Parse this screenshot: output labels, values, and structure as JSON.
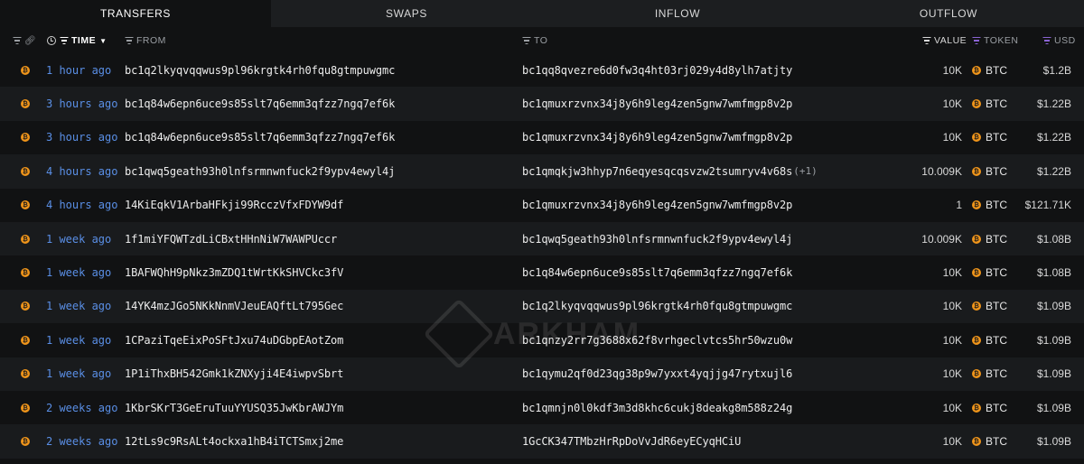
{
  "tabs": [
    {
      "label": "TRANSFERS",
      "active": true
    },
    {
      "label": "SWAPS",
      "active": false
    },
    {
      "label": "INFLOW",
      "active": false
    },
    {
      "label": "OUTFLOW",
      "active": false
    }
  ],
  "columns": {
    "time": "TIME",
    "from": "FROM",
    "to": "TO",
    "value": "VALUE",
    "token": "TOKEN",
    "usd": "USD"
  },
  "colors": {
    "time_link": "#5a8fe6",
    "btc": "#f0951a",
    "accent_purple": "#8a63d2"
  },
  "icons": {
    "row": "btc-coin-icon",
    "header_filter": "filter-icon",
    "header_link": "link-icon",
    "header_time": "clock-icon"
  },
  "watermark": "ARKHAM",
  "rows": [
    {
      "time": "1 hour ago",
      "from": "bc1q2lkyqvqqwus9pl96krgtk4rh0fqu8gtmpuwgmc",
      "to": "bc1qq8qvezre6d0fw3q4ht03rj029y4d8ylh7atjty",
      "to_extra": "",
      "value": "10K",
      "token": "BTC",
      "usd": "$1.2B"
    },
    {
      "time": "3 hours ago",
      "from": "bc1q84w6epn6uce9s85slt7q6emm3qfzz7ngq7ef6k",
      "to": "bc1qmuxrzvnx34j8y6h9leg4zen5gnw7wmfmgp8v2p",
      "to_extra": "",
      "value": "10K",
      "token": "BTC",
      "usd": "$1.22B"
    },
    {
      "time": "3 hours ago",
      "from": "bc1q84w6epn6uce9s85slt7q6emm3qfzz7ngq7ef6k",
      "to": "bc1qmuxrzvnx34j8y6h9leg4zen5gnw7wmfmgp8v2p",
      "to_extra": "",
      "value": "10K",
      "token": "BTC",
      "usd": "$1.22B"
    },
    {
      "time": "4 hours ago",
      "from": "bc1qwq5geath93h0lnfsrmnwnfuck2f9ypv4ewyl4j",
      "to": "bc1qmqkjw3hhyp7n6eqyesqcqsvzw2tsumryv4v68s",
      "to_extra": "(+1)",
      "value": "10.009K",
      "token": "BTC",
      "usd": "$1.22B"
    },
    {
      "time": "4 hours ago",
      "from": "14KiEqkV1ArbaHFkji99RcczVfxFDYW9df",
      "to": "bc1qmuxrzvnx34j8y6h9leg4zen5gnw7wmfmgp8v2p",
      "to_extra": "",
      "value": "1",
      "token": "BTC",
      "usd": "$121.71K"
    },
    {
      "time": "1 week ago",
      "from": "1f1miYFQWTzdLiCBxtHHnNiW7WAWPUccr",
      "to": "bc1qwq5geath93h0lnfsrmnwnfuck2f9ypv4ewyl4j",
      "to_extra": "",
      "value": "10.009K",
      "token": "BTC",
      "usd": "$1.08B"
    },
    {
      "time": "1 week ago",
      "from": "1BAFWQhH9pNkz3mZDQ1tWrtKkSHVCkc3fV",
      "to": "bc1q84w6epn6uce9s85slt7q6emm3qfzz7ngq7ef6k",
      "to_extra": "",
      "value": "10K",
      "token": "BTC",
      "usd": "$1.08B"
    },
    {
      "time": "1 week ago",
      "from": "14YK4mzJGo5NKkNnmVJeuEAQftLt795Gec",
      "to": "bc1q2lkyqvqqwus9pl96krgtk4rh0fqu8gtmpuwgmc",
      "to_extra": "",
      "value": "10K",
      "token": "BTC",
      "usd": "$1.09B"
    },
    {
      "time": "1 week ago",
      "from": "1CPaziTqeEixPoSFtJxu74uDGbpEAotZom",
      "to": "bc1qnzy2rr7g3688x62f8vrhgeclvtcs5hr50wzu0w",
      "to_extra": "",
      "value": "10K",
      "token": "BTC",
      "usd": "$1.09B"
    },
    {
      "time": "1 week ago",
      "from": "1P1iThxBH542Gmk1kZNXyji4E4iwpvSbrt",
      "to": "bc1qymu2qf0d23qg38p9w7yxxt4yqjjg47rytxujl6",
      "to_extra": "",
      "value": "10K",
      "token": "BTC",
      "usd": "$1.09B"
    },
    {
      "time": "2 weeks ago",
      "from": "1KbrSKrT3GeEruTuuYYUSQ35JwKbrAWJYm",
      "to": "bc1qmnjn0l0kdf3m3d8khc6cukj8deakg8m588z24g",
      "to_extra": "",
      "value": "10K",
      "token": "BTC",
      "usd": "$1.09B"
    },
    {
      "time": "2 weeks ago",
      "from": "12tLs9c9RsALt4ockxa1hB4iTCTSmxj2me",
      "to": "1GcCK347TMbzHrRpDoVvJdR6eyECyqHCiU",
      "to_extra": "",
      "value": "10K",
      "token": "BTC",
      "usd": "$1.09B"
    }
  ]
}
